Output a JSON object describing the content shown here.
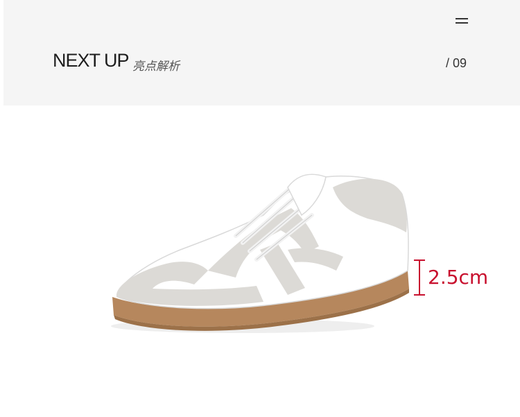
{
  "header": {
    "title": "NEXT UP",
    "subtitle": "亮点解析",
    "page_number": "/ 09"
  },
  "product": {
    "icon": "sneaker-illustration"
  },
  "measurement": {
    "label": "2.5cm",
    "color": "#c8102e"
  },
  "colors": {
    "header_bg": "#f5f5f5",
    "sole": "#b6875d",
    "suede": "#dcdad6",
    "leather": "#ffffff"
  }
}
